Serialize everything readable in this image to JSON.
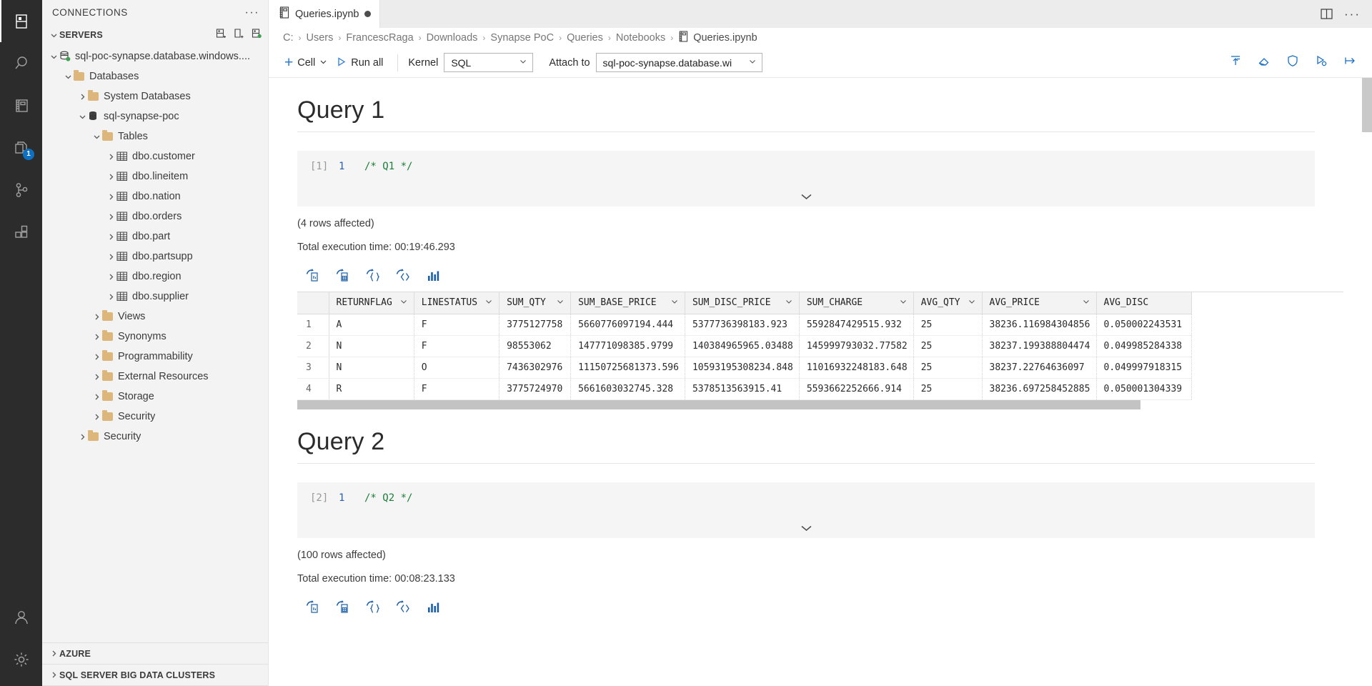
{
  "activitybar": {
    "items": [
      {
        "name": "connections",
        "icon": "servers-icon",
        "active": true,
        "badge": null
      },
      {
        "name": "search",
        "icon": "search-icon",
        "active": false,
        "badge": null
      },
      {
        "name": "notebooks",
        "icon": "notebook-icon",
        "active": false,
        "badge": null
      },
      {
        "name": "source-control",
        "icon": "files-icon",
        "active": false,
        "badge": "1"
      },
      {
        "name": "git",
        "icon": "git-branch-icon",
        "active": false,
        "badge": null
      },
      {
        "name": "extensions",
        "icon": "extensions-icon",
        "active": false,
        "badge": null
      }
    ],
    "bottom": [
      {
        "name": "accounts",
        "icon": "account-icon"
      },
      {
        "name": "settings",
        "icon": "gear-icon"
      }
    ]
  },
  "sidebar": {
    "title": "CONNECTIONS",
    "more_label": "···",
    "servers_section": {
      "label": "SERVERS",
      "actions": [
        "new-connection-icon",
        "new-connection-group-icon",
        "active-connections-icon"
      ]
    },
    "tree": [
      {
        "label": "sql-poc-synapse.database.windows....",
        "indent": 0,
        "twisty": "down",
        "icon": "server-icon",
        "status": "connected"
      },
      {
        "label": "Databases",
        "indent": 1,
        "twisty": "down",
        "icon": "folder-icon"
      },
      {
        "label": "System Databases",
        "indent": 2,
        "twisty": "right",
        "icon": "folder-icon"
      },
      {
        "label": "sql-synapse-poc",
        "indent": 2,
        "twisty": "down",
        "icon": "database-icon"
      },
      {
        "label": "Tables",
        "indent": 3,
        "twisty": "down",
        "icon": "folder-icon"
      },
      {
        "label": "dbo.customer",
        "indent": 4,
        "twisty": "right",
        "icon": "table-icon"
      },
      {
        "label": "dbo.lineitem",
        "indent": 4,
        "twisty": "right",
        "icon": "table-icon"
      },
      {
        "label": "dbo.nation",
        "indent": 4,
        "twisty": "right",
        "icon": "table-icon"
      },
      {
        "label": "dbo.orders",
        "indent": 4,
        "twisty": "right",
        "icon": "table-icon"
      },
      {
        "label": "dbo.part",
        "indent": 4,
        "twisty": "right",
        "icon": "table-icon"
      },
      {
        "label": "dbo.partsupp",
        "indent": 4,
        "twisty": "right",
        "icon": "table-icon"
      },
      {
        "label": "dbo.region",
        "indent": 4,
        "twisty": "right",
        "icon": "table-icon"
      },
      {
        "label": "dbo.supplier",
        "indent": 4,
        "twisty": "right",
        "icon": "table-icon"
      },
      {
        "label": "Views",
        "indent": 3,
        "twisty": "right",
        "icon": "folder-icon"
      },
      {
        "label": "Synonyms",
        "indent": 3,
        "twisty": "right",
        "icon": "folder-icon"
      },
      {
        "label": "Programmability",
        "indent": 3,
        "twisty": "right",
        "icon": "folder-icon"
      },
      {
        "label": "External Resources",
        "indent": 3,
        "twisty": "right",
        "icon": "folder-icon"
      },
      {
        "label": "Storage",
        "indent": 3,
        "twisty": "right",
        "icon": "folder-icon"
      },
      {
        "label": "Security",
        "indent": 3,
        "twisty": "right",
        "icon": "folder-icon"
      },
      {
        "label": "Security",
        "indent": 2,
        "twisty": "right",
        "icon": "folder-icon"
      }
    ],
    "bottom_sections": [
      {
        "label": "AZURE"
      },
      {
        "label": "SQL SERVER BIG DATA CLUSTERS"
      }
    ]
  },
  "tabbar": {
    "tabs": [
      {
        "label": "Queries.ipynb",
        "icon": "notebook-icon",
        "dirty": true,
        "active": true
      }
    ],
    "actions": [
      {
        "name": "split-editor-button",
        "icon": "split-editor-icon"
      },
      {
        "name": "editor-more-actions",
        "icon": "ellipsis-icon",
        "label": "···"
      }
    ]
  },
  "breadcrumb": {
    "separator": "›",
    "parts": [
      "C:",
      "Users",
      "FrancescRaga",
      "Downloads",
      "Synapse PoC",
      "Queries",
      "Notebooks"
    ],
    "file": "Queries.ipynb",
    "file_icon": "notebook-icon"
  },
  "notebook_toolbar": {
    "add_cell_label": "Cell",
    "add_cell_icon": "plus-icon",
    "run_all_label": "Run all",
    "run_all_icon": "play-icon",
    "kernel_label": "Kernel",
    "kernel_value": "SQL",
    "attach_label": "Attach to",
    "attach_value": "sql-poc-synapse.database.wi",
    "right_icons": [
      {
        "name": "collapse-cells-button",
        "icon": "collapse-icon"
      },
      {
        "name": "clear-results-button",
        "icon": "eraser-icon"
      },
      {
        "name": "trusted-button",
        "icon": "shield-icon"
      },
      {
        "name": "run-parameters-button",
        "icon": "run-with-params-icon"
      },
      {
        "name": "launch-button",
        "icon": "arrow-right-icon"
      }
    ]
  },
  "cells": [
    {
      "title": "Query 1",
      "exec_count": "[1]",
      "line_number": "1",
      "code": "/* Q1 */",
      "rows_affected": "(4 rows affected)",
      "execution_time": "Total execution time: 00:19:46.293",
      "result_actions": [
        {
          "name": "save-as-csv-button",
          "icon": "save-csv-icon"
        },
        {
          "name": "save-as-excel-button",
          "icon": "save-excel-icon"
        },
        {
          "name": "save-as-json-button",
          "icon": "save-json-icon"
        },
        {
          "name": "save-as-xml-button",
          "icon": "save-xml-icon"
        },
        {
          "name": "show-chart-button",
          "icon": "chart-icon"
        }
      ],
      "grid": {
        "columns": [
          "RETURNFLAG",
          "LINESTATUS",
          "SUM_QTY",
          "SUM_BASE_PRICE",
          "SUM_DISC_PRICE",
          "SUM_CHARGE",
          "AVG_QTY",
          "AVG_PRICE",
          "AVG_DISC"
        ],
        "rows": [
          {
            "n": "1",
            "cells": [
              "A",
              "F",
              "3775127758",
              "5660776097194.444",
              "5377736398183.923",
              "5592847429515.932",
              "25",
              "38236.116984304856",
              "0.050002243531"
            ]
          },
          {
            "n": "2",
            "cells": [
              "N",
              "F",
              "98553062",
              "147771098385.9799",
              "140384965965.03488",
              "145999793032.77582",
              "25",
              "38237.199388804474",
              "0.049985284338"
            ]
          },
          {
            "n": "3",
            "cells": [
              "N",
              "O",
              "7436302976",
              "11150725681373.596",
              "10593195308234.848",
              "11016932248183.648",
              "25",
              "38237.22764636097",
              "0.049997918315"
            ]
          },
          {
            "n": "4",
            "cells": [
              "R",
              "F",
              "3775724970",
              "5661603032745.328",
              "5378513563915.41",
              "5593662252666.914",
              "25",
              "38236.697258452885",
              "0.050001304339"
            ]
          }
        ]
      }
    },
    {
      "title": "Query 2",
      "exec_count": "[2]",
      "line_number": "1",
      "code": "/* Q2 */",
      "rows_affected": "(100 rows affected)",
      "execution_time": "Total execution time: 00:08:23.133",
      "result_actions": [
        {
          "name": "save-as-csv-button",
          "icon": "save-csv-icon"
        },
        {
          "name": "save-as-excel-button",
          "icon": "save-excel-icon"
        },
        {
          "name": "save-as-json-button",
          "icon": "save-json-icon"
        },
        {
          "name": "save-as-xml-button",
          "icon": "save-xml-icon"
        },
        {
          "name": "show-chart-button",
          "icon": "chart-icon"
        }
      ],
      "grid": null
    }
  ],
  "colors": {
    "accent": "#2b7cd3",
    "activitybar_bg": "#2c2c2c",
    "sidebar_bg": "#f3f3f3",
    "folder": "#dcb67a",
    "connected_status": "#3ea150",
    "badge": "#0e70c0",
    "code_comment": "#1a7f37",
    "line_number": "#2a5db0"
  }
}
